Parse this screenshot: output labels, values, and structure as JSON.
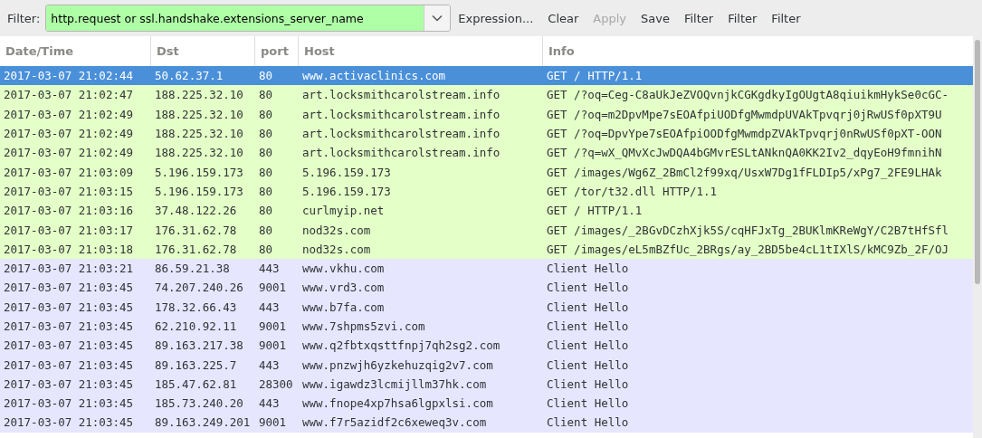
{
  "filter": {
    "label": "Filter:",
    "value": "http.request or ssl.handshake.extensions_server_name",
    "valid": true
  },
  "toolbar_buttons": [
    {
      "label": "Expression...",
      "disabled": false
    },
    {
      "label": "Clear",
      "disabled": false
    },
    {
      "label": "Apply",
      "disabled": true
    },
    {
      "label": "Save",
      "disabled": false
    },
    {
      "label": "Filter",
      "disabled": false
    },
    {
      "label": "Filter",
      "disabled": false
    },
    {
      "label": "Filter",
      "disabled": false
    }
  ],
  "table": {
    "columns": [
      "Date/Time",
      "Dst",
      "port",
      "Host",
      "Info"
    ],
    "rows": [
      {
        "kind": "http",
        "selected": true,
        "cells": [
          "2017-03-07 21:02:44",
          "50.62.37.1",
          "80",
          "www.activaclinics.com",
          "GET / HTTP/1.1"
        ]
      },
      {
        "kind": "http",
        "selected": false,
        "cells": [
          "2017-03-07 21:02:47",
          "188.225.32.10",
          "80",
          "art.locksmithcarolstream.info",
          "GET /?oq=Ceg-C8aUkJeZVOQvnjkCGKgdkyIgOUgtA8qiuikmHykSe0cGC-"
        ]
      },
      {
        "kind": "http",
        "selected": false,
        "cells": [
          "2017-03-07 21:02:49",
          "188.225.32.10",
          "80",
          "art.locksmithcarolstream.info",
          "GET /?oq=m2DpvMpe7sEOAfpiUODfgMwmdpUVAkTpvqrj0jRwUSf0pXT9U"
        ]
      },
      {
        "kind": "http",
        "selected": false,
        "cells": [
          "2017-03-07 21:02:49",
          "188.225.32.10",
          "80",
          "art.locksmithcarolstream.info",
          "GET /?oq=DpvYpe7sEOAfpiOODfgMwmdpZVAkTpvqrj0nRwUSf0pXT-OON"
        ]
      },
      {
        "kind": "http",
        "selected": false,
        "cells": [
          "2017-03-07 21:02:49",
          "188.225.32.10",
          "80",
          "art.locksmithcarolstream.info",
          "GET /?q=wX_QMvXcJwDQA4bGMvrESLtANknQA0KK2Iv2_dqyEoH9fmnihN"
        ]
      },
      {
        "kind": "http",
        "selected": false,
        "cells": [
          "2017-03-07 21:03:09",
          "5.196.159.173",
          "80",
          "5.196.159.173",
          "GET /images/Wg6Z_2BmCl2f99xq/UsxW7Dg1fFLDIp5/xPg7_2FE9LHAk"
        ]
      },
      {
        "kind": "http",
        "selected": false,
        "cells": [
          "2017-03-07 21:03:15",
          "5.196.159.173",
          "80",
          "5.196.159.173",
          "GET /tor/t32.dll HTTP/1.1"
        ]
      },
      {
        "kind": "http",
        "selected": false,
        "cells": [
          "2017-03-07 21:03:16",
          "37.48.122.26",
          "80",
          "curlmyip.net",
          "GET / HTTP/1.1"
        ]
      },
      {
        "kind": "http",
        "selected": false,
        "cells": [
          "2017-03-07 21:03:17",
          "176.31.62.78",
          "80",
          "nod32s.com",
          "GET /images/_2BGvDCzhXjk5S/cqHFJxTg_2BUKlmKReWgY/C2B7tHfSfl"
        ]
      },
      {
        "kind": "http",
        "selected": false,
        "cells": [
          "2017-03-07 21:03:18",
          "176.31.62.78",
          "80",
          "nod32s.com",
          "GET /images/eL5mBZfUc_2BRgs/ay_2BD5be4cL1tIXlS/kMC9Zb_2F/OJ"
        ]
      },
      {
        "kind": "ssl",
        "selected": false,
        "cells": [
          "2017-03-07 21:03:21",
          "86.59.21.38",
          "443",
          "www.vkhu.com",
          "Client Hello"
        ]
      },
      {
        "kind": "ssl",
        "selected": false,
        "cells": [
          "2017-03-07 21:03:45",
          "74.207.240.26",
          "9001",
          "www.vrd3.com",
          "Client Hello"
        ]
      },
      {
        "kind": "ssl",
        "selected": false,
        "cells": [
          "2017-03-07 21:03:45",
          "178.32.66.43",
          "443",
          "www.b7fa.com",
          "Client Hello"
        ]
      },
      {
        "kind": "ssl",
        "selected": false,
        "cells": [
          "2017-03-07 21:03:45",
          "62.210.92.11",
          "9001",
          "www.7shpms5zvi.com",
          "Client Hello"
        ]
      },
      {
        "kind": "ssl",
        "selected": false,
        "cells": [
          "2017-03-07 21:03:45",
          "89.163.217.38",
          "9001",
          "www.q2fbtxqsttfnpj7qh2sg2.com",
          "Client Hello"
        ]
      },
      {
        "kind": "ssl",
        "selected": false,
        "cells": [
          "2017-03-07 21:03:45",
          "89.163.225.7",
          "443",
          "www.pnzwjh6yzkehuzqig2v7.com",
          "Client Hello"
        ]
      },
      {
        "kind": "ssl",
        "selected": false,
        "cells": [
          "2017-03-07 21:03:45",
          "185.47.62.81",
          "28300",
          "www.igawdz3lcmijllm37hk.com",
          "Client Hello"
        ]
      },
      {
        "kind": "ssl",
        "selected": false,
        "cells": [
          "2017-03-07 21:03:45",
          "185.73.240.20",
          "443",
          "www.fnope4xp7hsa6lgpxlsi.com",
          "Client Hello"
        ]
      },
      {
        "kind": "ssl",
        "selected": false,
        "cells": [
          "2017-03-07 21:03:45",
          "89.163.249.201",
          "9001",
          "www.f7r5azidf2c6xeweq3v.com",
          "Client Hello"
        ]
      }
    ]
  }
}
